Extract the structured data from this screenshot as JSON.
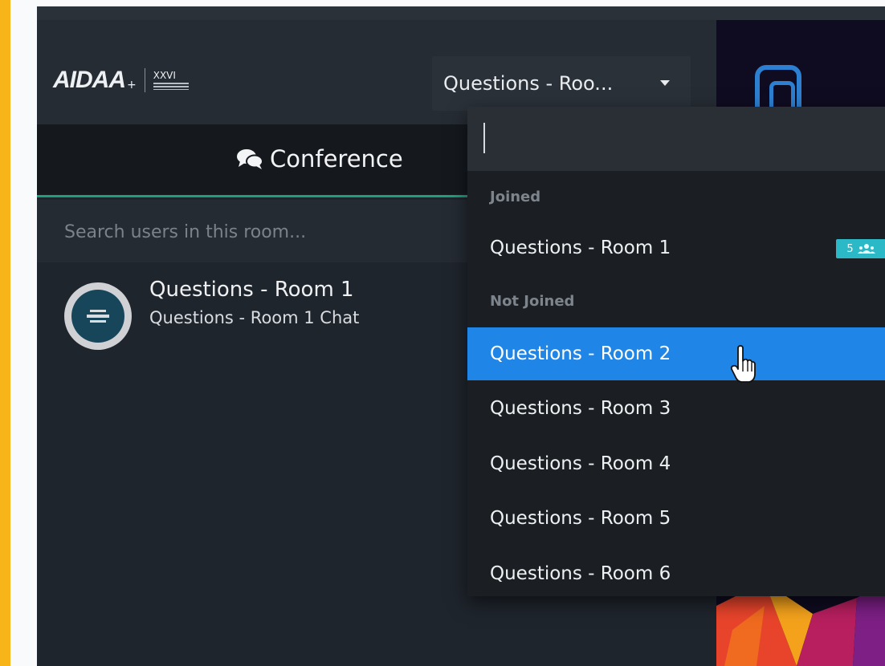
{
  "logo": {
    "brand": "AIDAA",
    "edition": "XXVI"
  },
  "header": {
    "room_select_value": "Questions - Roo..."
  },
  "tabs": [
    {
      "label": "Conference"
    }
  ],
  "search": {
    "placeholder": "Search users in this room..."
  },
  "room_list": [
    {
      "name": "Questions - Room 1",
      "subtitle": "Questions - Room 1 Chat"
    }
  ],
  "dropdown": {
    "search_value": "",
    "groups": [
      {
        "label": "Joined",
        "items": [
          {
            "label": "Questions - Room 1",
            "badge": "5"
          }
        ]
      },
      {
        "label": "Not Joined",
        "items": [
          {
            "label": "Questions - Room 2"
          },
          {
            "label": "Questions - Room 3"
          },
          {
            "label": "Questions - Room 4"
          },
          {
            "label": "Questions - Room 5"
          },
          {
            "label": "Questions - Room 6"
          }
        ]
      }
    ]
  },
  "colors": {
    "accent_yellow": "#f7b519",
    "highlight_blue": "#1f86e8",
    "tab_underline_green": "#1f9f7a",
    "badge_teal": "#2bb8c7",
    "app_background": "#1f252d"
  },
  "icons": {
    "tab": "comments-icon",
    "select": "caret-down-icon",
    "badge": "users-icon",
    "pointer": "hand-pointer-icon"
  }
}
